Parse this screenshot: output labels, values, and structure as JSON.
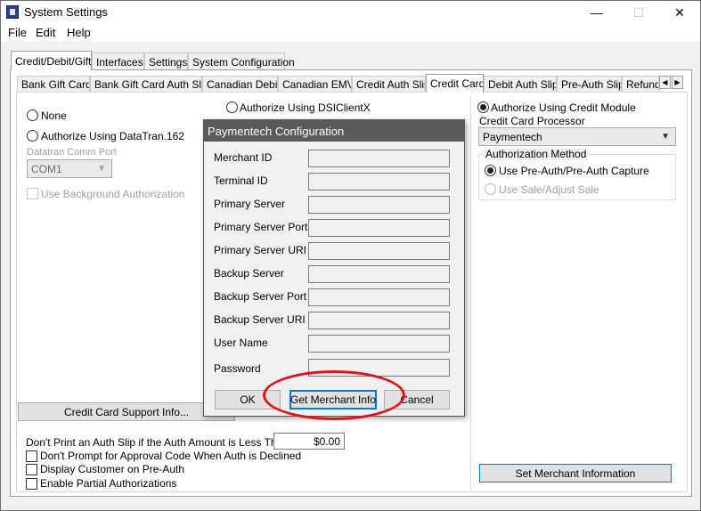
{
  "window": {
    "title": "System Settings",
    "controls": {
      "minimize": "—",
      "maximize": "☐",
      "close": "✕"
    }
  },
  "menu": {
    "file": "File",
    "edit": "Edit",
    "help": "Help"
  },
  "top_tabs": [
    "Credit/Debit/Gift",
    "Interfaces",
    "Settings",
    "System Configuration"
  ],
  "sub_tabs": [
    "Bank Gift Card",
    "Bank Gift Card Auth Slip",
    "Canadian Debit",
    "Canadian EMV",
    "Credit Auth Slip",
    "Credit Card",
    "Debit Auth Slip",
    "Pre-Auth Slip",
    "Refund"
  ],
  "left": {
    "none": "None",
    "datatran": "Authorize Using DataTran.162",
    "comm_port_label": "Datatran Comm Port",
    "comm_port_value": "COM1",
    "background_auth": "Use Background Authorization",
    "support_button": "Credit Card Support Info...",
    "min_amount_label": "Don't Print an Auth Slip if the Auth Amount is Less Than",
    "min_amount_value": "$0.00",
    "opt_no_prompt": "Don't Prompt for Approval Code When Auth is Declined",
    "opt_display_customer": "Display Customer on Pre-Auth",
    "opt_partial": "Enable Partial Authorizations"
  },
  "middle": {
    "dsiclientx": "Authorize Using DSIClientX"
  },
  "right": {
    "credit_module": "Authorize Using Credit Module",
    "processor_label": "Credit Card Processor",
    "processor_value": "Paymentech",
    "method_legend": "Authorization Method",
    "method_preauth": "Use Pre-Auth/Pre-Auth Capture",
    "method_sale": "Use Sale/Adjust Sale",
    "set_merchant_button": "Set Merchant Information"
  },
  "dialog": {
    "title": "Paymentech Configuration",
    "fields": [
      "Merchant ID",
      "Terminal ID",
      "Primary Server",
      "Primary Server Port",
      "Primary Server URI",
      "Backup Server",
      "Backup Server Port",
      "Backup Server URI",
      "User Name",
      "Password"
    ],
    "ok": "OK",
    "get_merchant_info": "Get Merchant Info",
    "cancel": "Cancel"
  },
  "colors": {
    "annotation": "#e0121c",
    "dialog_title_bg": "#5a5a5a",
    "focus_border": "#0078d7"
  }
}
